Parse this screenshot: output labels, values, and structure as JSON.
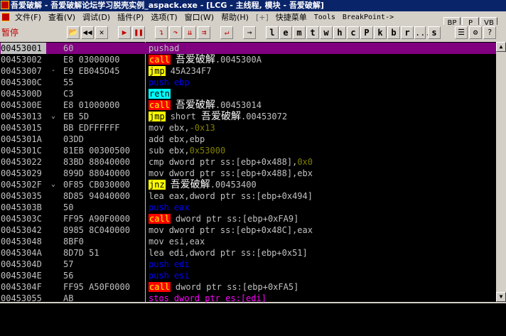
{
  "window": {
    "title": "吾爱破解 - 吾爱破解论坛学习脱壳实例_aspack.exe - [LCG - 主线程, 模块 - 吾爱破解]"
  },
  "menu": {
    "items": [
      "文件(F)",
      "查看(V)",
      "调试(D)",
      "插件(P)",
      "选项(T)",
      "窗口(W)",
      "帮助(H)",
      "[+]",
      "快捷菜单",
      "Tools",
      "BreakPoint->"
    ]
  },
  "side_buttons": [
    "BP",
    "P",
    "VB"
  ],
  "toolbar": {
    "status": "暂停",
    "icons": [
      {
        "name": "open-icon",
        "glyph": "📂"
      },
      {
        "name": "restart-icon",
        "glyph": "◀◀"
      },
      {
        "name": "close-icon",
        "glyph": "✕"
      },
      {
        "name": "run-icon",
        "glyph": "▶"
      },
      {
        "name": "pause-icon",
        "glyph": "❚❚"
      },
      {
        "name": "step-into-icon",
        "glyph": "↴"
      },
      {
        "name": "step-over-icon",
        "glyph": "↷"
      },
      {
        "name": "trace-into-icon",
        "glyph": "⇊"
      },
      {
        "name": "trace-over-icon",
        "glyph": "⇉"
      },
      {
        "name": "execute-till-return-icon",
        "glyph": "↵"
      },
      {
        "name": "goto-icon",
        "glyph": "→"
      }
    ],
    "letters": [
      "l",
      "e",
      "m",
      "t",
      "w",
      "h",
      "c",
      "P",
      "k",
      "b",
      "r",
      "...",
      "s"
    ],
    "right_icons": [
      {
        "name": "list-icon",
        "glyph": "☰"
      },
      {
        "name": "settings-icon",
        "glyph": "⚙"
      },
      {
        "name": "help-icon",
        "glyph": "?"
      }
    ]
  },
  "disasm": {
    "rows": [
      {
        "addr": "00453001",
        "arrow": "",
        "hex": "60",
        "mnem": "pushad",
        "ops": [],
        "selected": true
      },
      {
        "addr": "00453002",
        "arrow": "",
        "hex": "E8 03000000",
        "mnem": "call",
        "ops": [
          {
            "t": "吾爱破解",
            "c": "cn"
          },
          {
            "t": ".0045300A",
            "c": "w"
          }
        ]
      },
      {
        "addr": "00453007",
        "arrow": "-",
        "hex": "E9 EB045D45",
        "mnem": "jmp",
        "ops": [
          {
            "t": "45A234F7",
            "c": "w"
          }
        ]
      },
      {
        "addr": "0045300C",
        "arrow": "",
        "hex": "55",
        "mnem": "push",
        "ops": [
          {
            "t": "ebp",
            "c": "b"
          }
        ]
      },
      {
        "addr": "0045300D",
        "arrow": "",
        "hex": "C3",
        "mnem": "retn",
        "ops": []
      },
      {
        "addr": "0045300E",
        "arrow": "",
        "hex": "E8 01000000",
        "mnem": "call",
        "ops": [
          {
            "t": "吾爱破解",
            "c": "cn"
          },
          {
            "t": ".00453014",
            "c": "w"
          }
        ]
      },
      {
        "addr": "00453013",
        "arrow": "⌄",
        "hex": "EB 5D",
        "mnem": "jmp",
        "ops": [
          {
            "t": "short ",
            "c": "w"
          },
          {
            "t": "吾爱破解",
            "c": "cn"
          },
          {
            "t": ".00453072",
            "c": "w"
          }
        ]
      },
      {
        "addr": "00453015",
        "arrow": "",
        "hex": "BB EDFFFFFF",
        "mnem": "mov",
        "ops": [
          {
            "t": "ebx,",
            "c": "w"
          },
          {
            "t": "-0x13",
            "c": "num"
          }
        ]
      },
      {
        "addr": "0045301A",
        "arrow": "",
        "hex": "03DD",
        "mnem": "add",
        "ops": [
          {
            "t": "ebx,ebp",
            "c": "w"
          }
        ]
      },
      {
        "addr": "0045301C",
        "arrow": "",
        "hex": "81EB 00300500",
        "mnem": "sub",
        "ops": [
          {
            "t": "ebx,",
            "c": "w"
          },
          {
            "t": "0x53000",
            "c": "num"
          }
        ]
      },
      {
        "addr": "00453022",
        "arrow": "",
        "hex": "83BD 88040000",
        "mnem": "cmp",
        "ops": [
          {
            "t": "dword ptr ss:[ebp+0x488],",
            "c": "w"
          },
          {
            "t": "0x0",
            "c": "num"
          }
        ]
      },
      {
        "addr": "00453029",
        "arrow": "",
        "hex": "899D 88040000",
        "mnem": "mov",
        "ops": [
          {
            "t": "dword ptr ss:[ebp+0x488],ebx",
            "c": "w"
          }
        ]
      },
      {
        "addr": "0045302F",
        "arrow": "⌄",
        "hex": "0F85 CB030000",
        "mnem": "jnz",
        "ops": [
          {
            "t": "吾爱破解",
            "c": "cn"
          },
          {
            "t": ".00453400",
            "c": "w"
          }
        ]
      },
      {
        "addr": "00453035",
        "arrow": "",
        "hex": "8D85 94040000",
        "mnem": "lea",
        "ops": [
          {
            "t": "eax,dword ptr ss:[ebp+0x494]",
            "c": "w"
          }
        ]
      },
      {
        "addr": "0045303B",
        "arrow": "",
        "hex": "50",
        "mnem": "push",
        "ops": [
          {
            "t": "eax",
            "c": "b"
          }
        ]
      },
      {
        "addr": "0045303C",
        "arrow": "",
        "hex": "FF95 A90F0000",
        "mnem": "call",
        "ops": [
          {
            "t": "dword ptr ss:[ebp+0xFA9]",
            "c": "w"
          }
        ]
      },
      {
        "addr": "00453042",
        "arrow": "",
        "hex": "8985 8C040000",
        "mnem": "mov",
        "ops": [
          {
            "t": "dword ptr ss:[ebp+0x48C],eax",
            "c": "w"
          }
        ]
      },
      {
        "addr": "00453048",
        "arrow": "",
        "hex": "8BF0",
        "mnem": "mov",
        "ops": [
          {
            "t": "esi,eax",
            "c": "w"
          }
        ]
      },
      {
        "addr": "0045304A",
        "arrow": "",
        "hex": "8D7D 51",
        "mnem": "lea",
        "ops": [
          {
            "t": "edi,dword ptr ss:[ebp+0x51]",
            "c": "w"
          }
        ]
      },
      {
        "addr": "0045304D",
        "arrow": "",
        "hex": "57",
        "mnem": "push",
        "ops": [
          {
            "t": "edi",
            "c": "b"
          }
        ]
      },
      {
        "addr": "0045304E",
        "arrow": "",
        "hex": "56",
        "mnem": "push",
        "ops": [
          {
            "t": "esi",
            "c": "b"
          }
        ]
      },
      {
        "addr": "0045304F",
        "arrow": "",
        "hex": "FF95 A50F0000",
        "mnem": "call",
        "ops": [
          {
            "t": "dword ptr ss:[ebp+0xFA5]",
            "c": "w"
          }
        ]
      },
      {
        "addr": "00453055",
        "arrow": "",
        "hex": "AB",
        "mnem": "stos",
        "ops": [
          {
            "t": "dword ptr es:[edi]",
            "c": "m"
          }
        ]
      }
    ]
  },
  "colors": {
    "selection": "#800080",
    "call_bg": "#ff0000",
    "jmp_bg": "#ffff00",
    "retn_bg": "#00ffff",
    "push_fg": "#0000ff",
    "const_fg": "#808000",
    "titlebar": "#0a246a"
  }
}
